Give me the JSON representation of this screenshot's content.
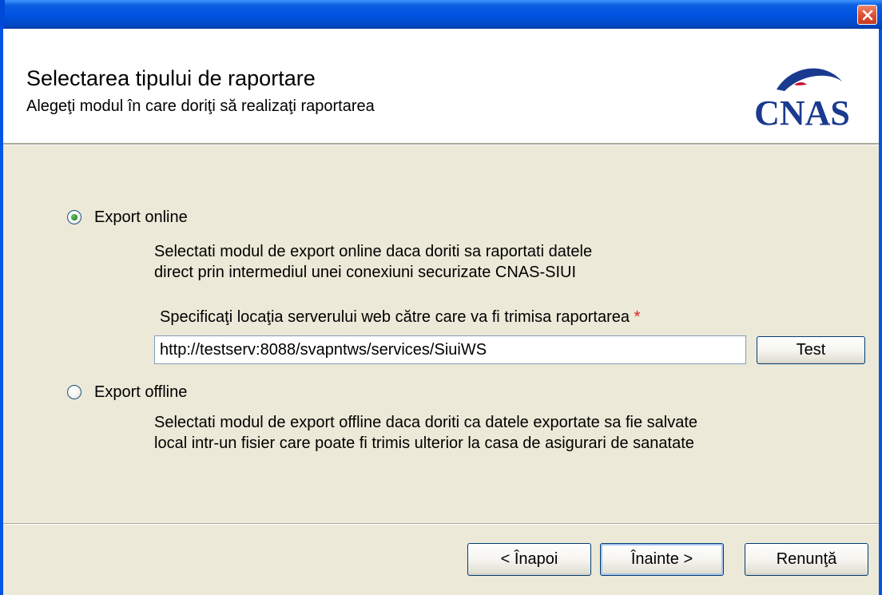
{
  "window": {
    "title": "",
    "close_icon": "close-icon",
    "frame_color": "#0055E5",
    "close_color": "#E0553A"
  },
  "header": {
    "title": "Selectarea tipului de raportare",
    "subtitle": "Alegeţi modul în care doriţi să realizaţi raportarea",
    "logo_text": "CNAS",
    "logo_color": "#1A3A8F"
  },
  "options": {
    "online": {
      "label": "Export online",
      "selected": true,
      "description_line1": "Selectati modul de export online daca doriti sa raportati datele",
      "description_line2": "direct prin intermediul unei conexiuni securizate CNAS-SIUI"
    },
    "server": {
      "label": "Specificaţi locaţia serverului web către care va fi trimisa raportarea",
      "required_mark": "*",
      "url_value": "http://testserv:8088/svapntws/services/SiuiWS",
      "test_label": "Test"
    },
    "offline": {
      "label": "Export offline",
      "selected": false,
      "description_line1": "Selectati modul de export offline daca doriti ca datele exportate sa fie salvate",
      "description_line2": "local intr-un fisier care poate fi trimis ulterior la casa de asigurari de sanatate"
    }
  },
  "footer": {
    "back_label": "< Înapoi",
    "next_label": "Înainte >",
    "cancel_label": "Renunţă"
  },
  "colors": {
    "dialog_bg": "#ECE9D8",
    "required_star": "#E31C1C",
    "radio_selected": "#2A9632"
  }
}
